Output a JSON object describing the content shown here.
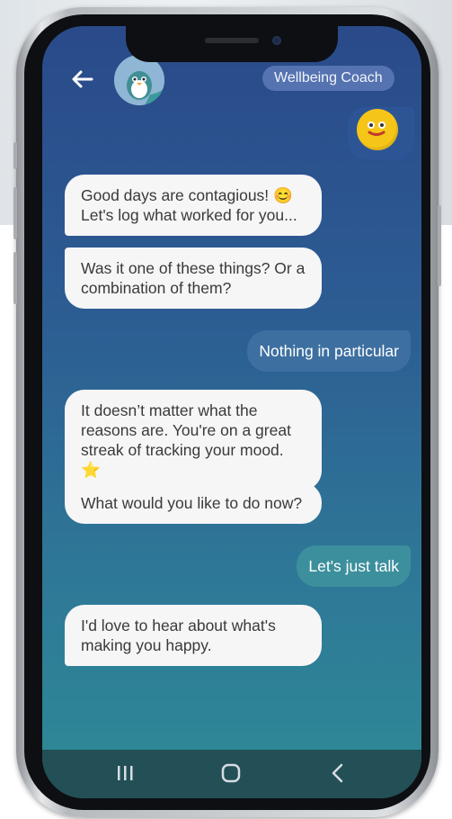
{
  "header": {
    "coach_label": "Wellbeing Coach"
  },
  "messages": [
    {
      "sender": "coach",
      "text": "Good days are contagious! 😊 Let's log what worked for you..."
    },
    {
      "sender": "coach",
      "text": "Was it one of these things? Or a combination of them?"
    },
    {
      "sender": "user",
      "text": "Nothing in particular"
    },
    {
      "sender": "coach",
      "text": "It doesn’t matter what the reasons are. You're on a great streak of tracking your mood. ⭐"
    },
    {
      "sender": "coach",
      "text": "What would you like to do now?"
    },
    {
      "sender": "user",
      "text": "Let's just talk"
    },
    {
      "sender": "coach",
      "text": "I'd love to hear about what's making you happy."
    }
  ],
  "icons": {
    "back": "arrow-left-icon",
    "avatar": "penguin-avatar",
    "user_emoji": "smiley-face-icon",
    "nav": [
      "recent-apps-icon",
      "home-icon",
      "back-chevron-icon"
    ]
  },
  "colors": {
    "gradient_top": "#2a4a8a",
    "gradient_bottom": "#2e8b96",
    "bubble": "#f6f6f6",
    "user_reply": "#3d70a0",
    "badge": "#5573b0",
    "navbar": "#234f56"
  }
}
